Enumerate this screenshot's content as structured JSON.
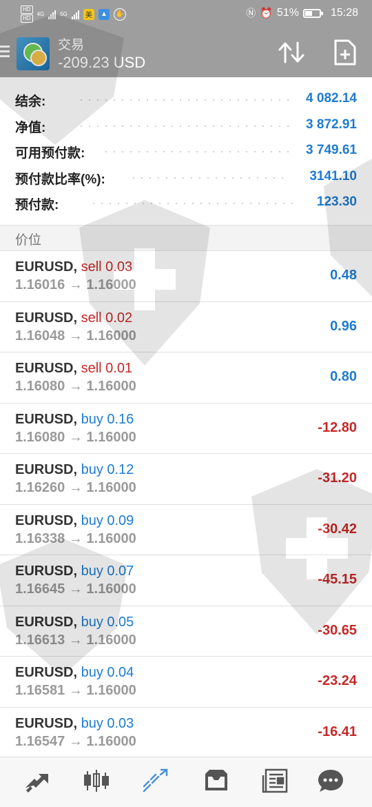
{
  "status_bar": {
    "left_badges": [
      "HD",
      "4G",
      "5G"
    ],
    "battery": "51%",
    "battery_level": 0.51,
    "time": "15:28",
    "icons": [
      "nfc-icon",
      "alarm-icon"
    ]
  },
  "toolbar": {
    "title": "交易",
    "balance": "-209.23 USD",
    "icons": [
      "menu-icon",
      "app-logo",
      "sort-icon",
      "new-order-icon"
    ]
  },
  "summary": [
    {
      "label": "结余:",
      "value": "4 082.14"
    },
    {
      "label": "净值:",
      "value": "3 872.91"
    },
    {
      "label": "可用预付款:",
      "value": "3 749.61"
    },
    {
      "label": "预付款比率(%):",
      "value": "3141.10"
    },
    {
      "label": "预付款:",
      "value": "123.30"
    }
  ],
  "section_title": "价位",
  "positions": [
    {
      "symbol": "EURUSD,",
      "side": "sell 0.03",
      "type": "sell",
      "prices": "1.16016 → 1.16000",
      "profit": "0.48"
    },
    {
      "symbol": "EURUSD,",
      "side": "sell 0.02",
      "type": "sell",
      "prices": "1.16048 → 1.16000",
      "profit": "0.96"
    },
    {
      "symbol": "EURUSD,",
      "side": "sell 0.01",
      "type": "sell",
      "prices": "1.16080 → 1.16000",
      "profit": "0.80"
    },
    {
      "symbol": "EURUSD,",
      "side": "buy 0.16",
      "type": "buy",
      "prices": "1.16080 → 1.16000",
      "profit": "-12.80"
    },
    {
      "symbol": "EURUSD,",
      "side": "buy 0.12",
      "type": "buy",
      "prices": "1.16260 → 1.16000",
      "profit": "-31.20"
    },
    {
      "symbol": "EURUSD,",
      "side": "buy 0.09",
      "type": "buy",
      "prices": "1.16338 → 1.16000",
      "profit": "-30.42"
    },
    {
      "symbol": "EURUSD,",
      "side": "buy 0.07",
      "type": "buy",
      "prices": "1.16645 → 1.16000",
      "profit": "-45.15"
    },
    {
      "symbol": "EURUSD,",
      "side": "buy 0.05",
      "type": "buy",
      "prices": "1.16613 → 1.16000",
      "profit": "-30.65"
    },
    {
      "symbol": "EURUSD,",
      "side": "buy 0.04",
      "type": "buy",
      "prices": "1.16581 → 1.16000",
      "profit": "-23.24"
    },
    {
      "symbol": "EURUSD,",
      "side": "buy 0.03",
      "type": "buy",
      "prices": "1.16547 → 1.16000",
      "profit": "-16.41"
    }
  ],
  "bottom_nav": [
    {
      "name": "quotes-icon",
      "active": false
    },
    {
      "name": "chart-candles-icon",
      "active": false
    },
    {
      "name": "trade-icon",
      "active": true
    },
    {
      "name": "history-inbox-icon",
      "active": false
    },
    {
      "name": "news-icon",
      "active": false
    },
    {
      "name": "chat-icon",
      "active": false
    }
  ],
  "colors": {
    "positive": "#1e7bd1",
    "negative": "#c62828",
    "toolbar": "#9e9e9e",
    "active_nav": "#4a90d9"
  }
}
